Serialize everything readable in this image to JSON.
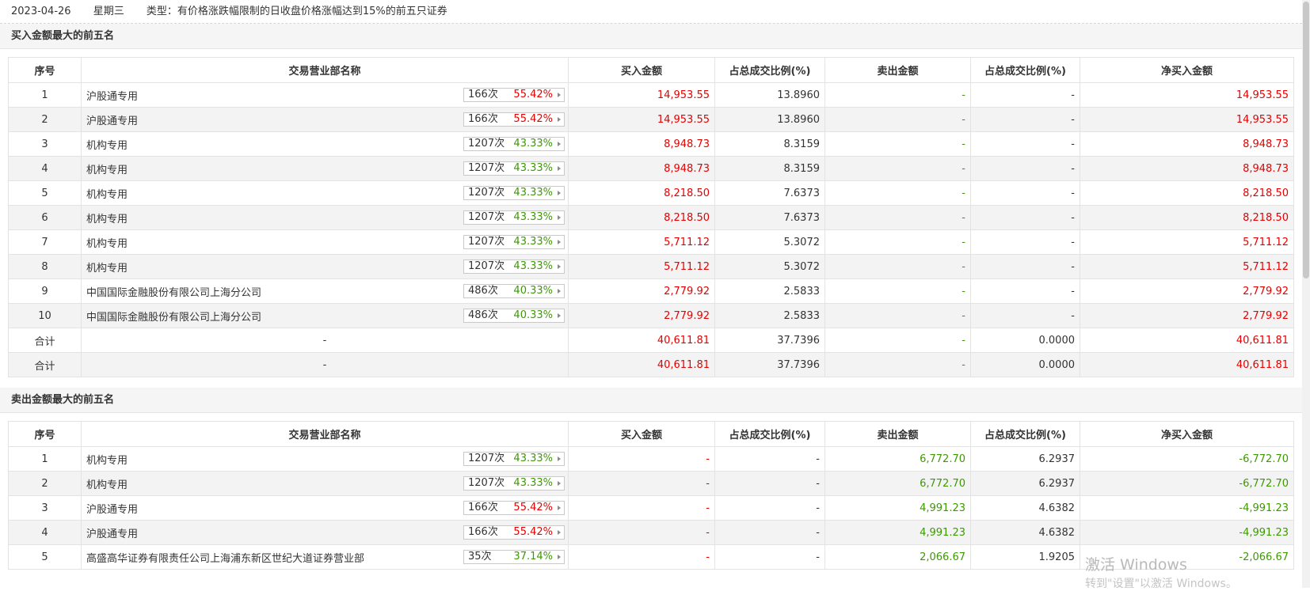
{
  "header": {
    "date": "2023-04-26",
    "weekday": "星期三",
    "type_text": "类型：有价格涨跌幅限制的日收盘价格涨幅达到15%的前五只证券"
  },
  "buy_section": {
    "title": "买入金额最大的前五名",
    "columns": [
      "序号",
      "交易营业部名称",
      "买入金额",
      "占总成交比例(%)",
      "卖出金额",
      "占总成交比例(%)",
      "净买入金额"
    ],
    "rows": [
      {
        "no": "1",
        "name": "沪股通专用",
        "count": "166次",
        "pct": "55.42%",
        "pct_color": "red",
        "buy": "14,953.55",
        "buy_ratio": "13.8960",
        "sell": "-",
        "sell_ratio": "-",
        "net": "14,953.55"
      },
      {
        "no": "2",
        "name": "沪股通专用",
        "count": "166次",
        "pct": "55.42%",
        "pct_color": "red",
        "buy": "14,953.55",
        "buy_ratio": "13.8960",
        "sell": "-",
        "sell_ratio": "-",
        "net": "14,953.55"
      },
      {
        "no": "3",
        "name": "机构专用",
        "count": "1207次",
        "pct": "43.33%",
        "pct_color": "green",
        "buy": "8,948.73",
        "buy_ratio": "8.3159",
        "sell": "-",
        "sell_ratio": "-",
        "net": "8,948.73"
      },
      {
        "no": "4",
        "name": "机构专用",
        "count": "1207次",
        "pct": "43.33%",
        "pct_color": "green",
        "buy": "8,948.73",
        "buy_ratio": "8.3159",
        "sell": "-",
        "sell_ratio": "-",
        "net": "8,948.73"
      },
      {
        "no": "5",
        "name": "机构专用",
        "count": "1207次",
        "pct": "43.33%",
        "pct_color": "green",
        "buy": "8,218.50",
        "buy_ratio": "7.6373",
        "sell": "-",
        "sell_ratio": "-",
        "net": "8,218.50"
      },
      {
        "no": "6",
        "name": "机构专用",
        "count": "1207次",
        "pct": "43.33%",
        "pct_color": "green",
        "buy": "8,218.50",
        "buy_ratio": "7.6373",
        "sell": "-",
        "sell_ratio": "-",
        "net": "8,218.50"
      },
      {
        "no": "7",
        "name": "机构专用",
        "count": "1207次",
        "pct": "43.33%",
        "pct_color": "green",
        "buy": "5,711.12",
        "buy_ratio": "5.3072",
        "sell": "-",
        "sell_ratio": "-",
        "net": "5,711.12"
      },
      {
        "no": "8",
        "name": "机构专用",
        "count": "1207次",
        "pct": "43.33%",
        "pct_color": "green",
        "buy": "5,711.12",
        "buy_ratio": "5.3072",
        "sell": "-",
        "sell_ratio": "-",
        "net": "5,711.12"
      },
      {
        "no": "9",
        "name": "中国国际金融股份有限公司上海分公司",
        "count": "486次",
        "pct": "40.33%",
        "pct_color": "green",
        "buy": "2,779.92",
        "buy_ratio": "2.5833",
        "sell": "-",
        "sell_ratio": "-",
        "net": "2,779.92"
      },
      {
        "no": "10",
        "name": "中国国际金融股份有限公司上海分公司",
        "count": "486次",
        "pct": "40.33%",
        "pct_color": "green",
        "buy": "2,779.92",
        "buy_ratio": "2.5833",
        "sell": "-",
        "sell_ratio": "-",
        "net": "2,779.92"
      }
    ],
    "totals": [
      {
        "label": "合计",
        "name": "-",
        "buy": "40,611.81",
        "buy_ratio": "37.7396",
        "sell": "-",
        "sell_ratio": "0.0000",
        "net": "40,611.81"
      },
      {
        "label": "合计",
        "name": "-",
        "buy": "40,611.81",
        "buy_ratio": "37.7396",
        "sell": "-",
        "sell_ratio": "0.0000",
        "net": "40,611.81"
      }
    ]
  },
  "sell_section": {
    "title": "卖出金额最大的前五名",
    "columns": [
      "序号",
      "交易营业部名称",
      "买入金额",
      "占总成交比例(%)",
      "卖出金额",
      "占总成交比例(%)",
      "净买入金额"
    ],
    "rows": [
      {
        "no": "1",
        "name": "机构专用",
        "count": "1207次",
        "pct": "43.33%",
        "pct_color": "green",
        "buy": "-",
        "buy_ratio": "-",
        "sell": "6,772.70",
        "sell_ratio": "6.2937",
        "net": "-6,772.70"
      },
      {
        "no": "2",
        "name": "机构专用",
        "count": "1207次",
        "pct": "43.33%",
        "pct_color": "green",
        "buy": "-",
        "buy_ratio": "-",
        "sell": "6,772.70",
        "sell_ratio": "6.2937",
        "net": "-6,772.70"
      },
      {
        "no": "3",
        "name": "沪股通专用",
        "count": "166次",
        "pct": "55.42%",
        "pct_color": "red",
        "buy": "-",
        "buy_ratio": "-",
        "sell": "4,991.23",
        "sell_ratio": "4.6382",
        "net": "-4,991.23"
      },
      {
        "no": "4",
        "name": "沪股通专用",
        "count": "166次",
        "pct": "55.42%",
        "pct_color": "red",
        "buy": "-",
        "buy_ratio": "-",
        "sell": "4,991.23",
        "sell_ratio": "4.6382",
        "net": "-4,991.23"
      },
      {
        "no": "5",
        "name": "高盛高华证券有限责任公司上海浦东新区世纪大道证券营业部",
        "count": "35次",
        "pct": "37.14%",
        "pct_color": "green",
        "buy": "-",
        "buy_ratio": "-",
        "sell": "2,066.67",
        "sell_ratio": "1.9205",
        "net": "-2,066.67"
      }
    ]
  },
  "watermark": {
    "line1": "激活 Windows",
    "line2": "转到\"设置\"以激活 Windows。"
  },
  "colors": {
    "red": "#e60000",
    "green": "#3c9a00"
  }
}
